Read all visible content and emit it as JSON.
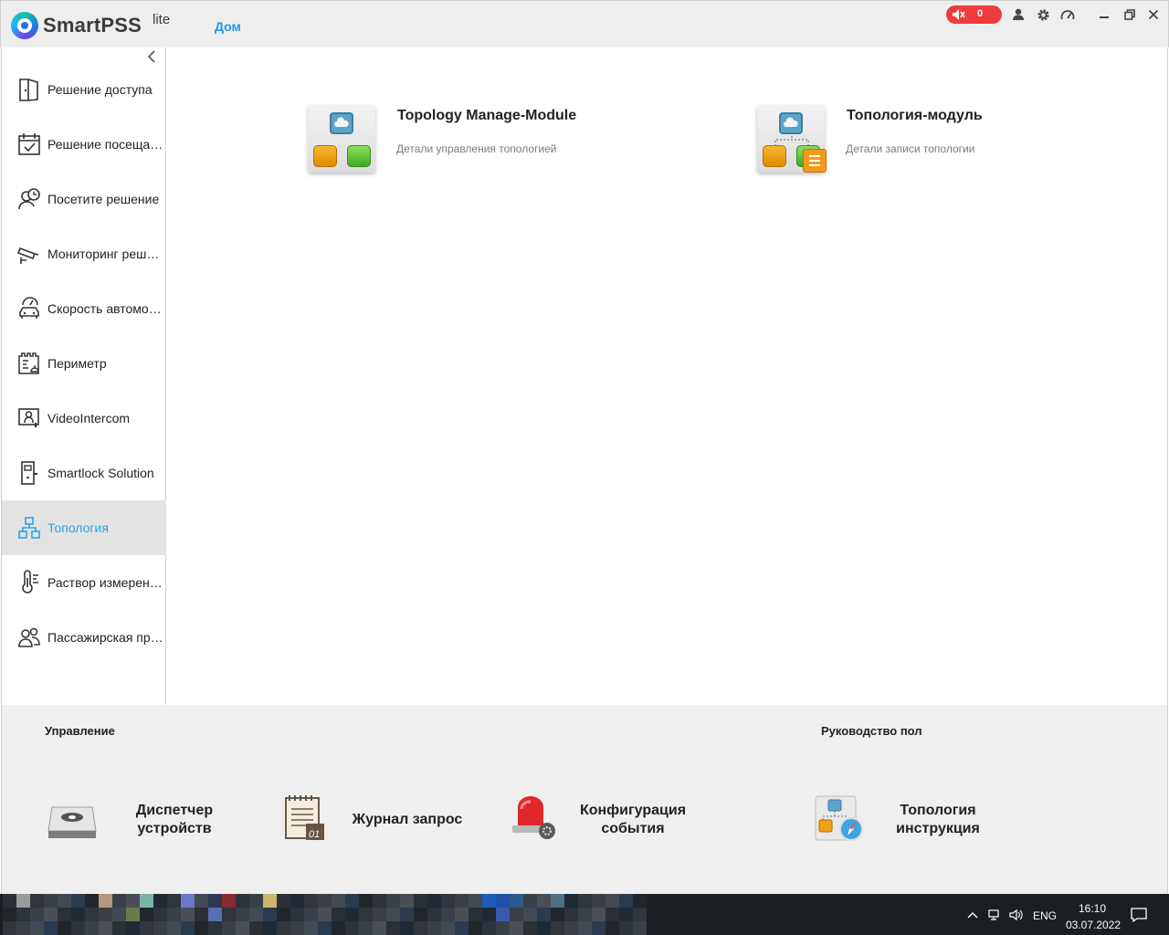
{
  "app": {
    "name": "SmartPSS",
    "edition": "lite",
    "home_tab": "Дом"
  },
  "toolbar": {
    "alarm_count": "0"
  },
  "sidebar": {
    "items": [
      {
        "label": "Решение доступа",
        "icon": "door-icon"
      },
      {
        "label": "Решение посещаемости",
        "icon": "calendar-check-icon"
      },
      {
        "label": "Посетите решение",
        "icon": "visitor-clock-icon"
      },
      {
        "label": "Мониторинг решение",
        "icon": "camera-icon"
      },
      {
        "label": "Скорость автомобиля",
        "icon": "car-speed-icon"
      },
      {
        "label": "Периметр",
        "icon": "perimeter-icon"
      },
      {
        "label": "VideoIntercom",
        "icon": "intercom-icon"
      },
      {
        "label": "Smartlock Solution",
        "icon": "smartlock-icon"
      },
      {
        "label": "Топология",
        "icon": "topology-icon",
        "active": true
      },
      {
        "label": "Раствор измерения температуры",
        "icon": "thermometer-icon"
      },
      {
        "label": "Пассажирская программа",
        "icon": "people-icon"
      }
    ]
  },
  "main": {
    "cards": [
      {
        "title": "Topology Manage-Module",
        "desc": "Детали управления топологией"
      },
      {
        "title": "Топология-модуль",
        "desc": "Детали записи топологии"
      }
    ]
  },
  "bottom": {
    "manage_title": "Управление",
    "guide_title": "Руководство пол",
    "tools": [
      {
        "line1": "Диспетчер",
        "line2": "устройств"
      },
      {
        "line1": "Журнал запрос",
        "line2": ""
      },
      {
        "line1": "Конфигурация",
        "line2": "события"
      },
      {
        "line1": "Топология",
        "line2": "инструкция"
      }
    ]
  },
  "taskbar": {
    "lang": "ENG",
    "time": "16:10",
    "date": "03.07.2022"
  }
}
